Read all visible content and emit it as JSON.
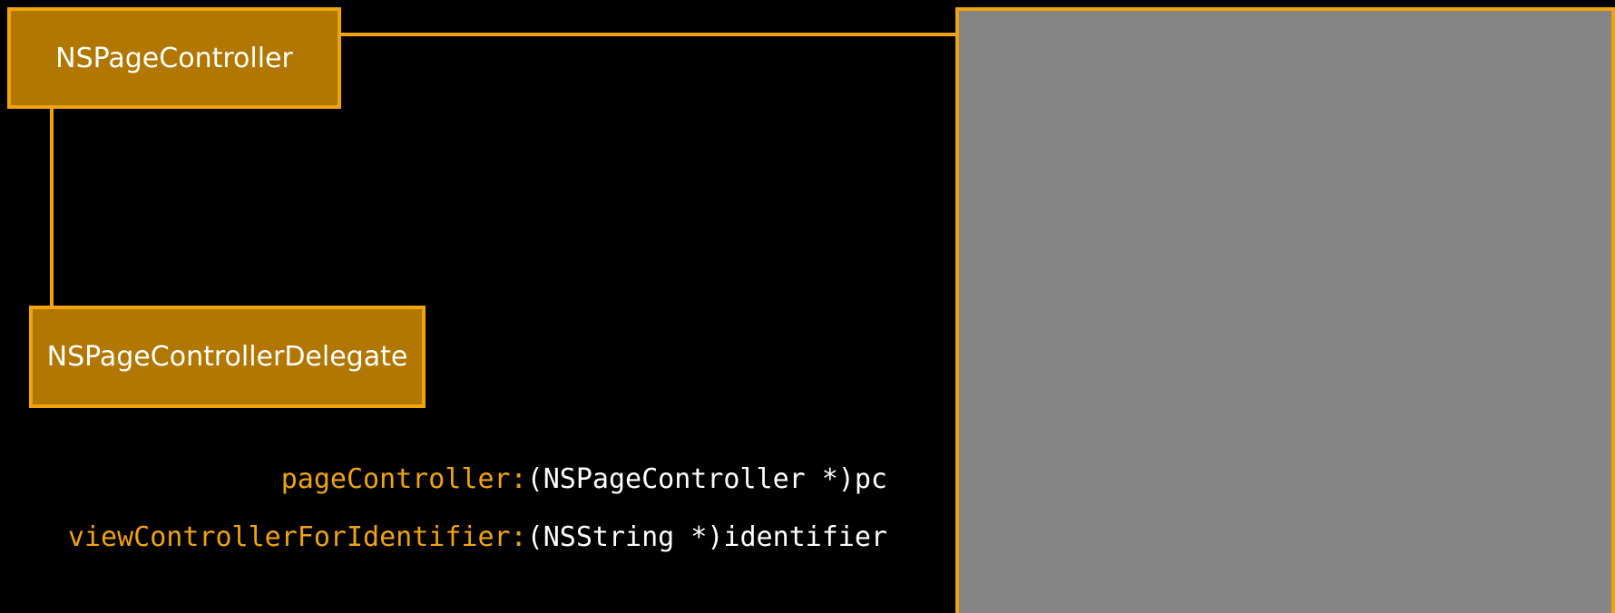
{
  "diagram": {
    "page_controller_box": {
      "label": "NSPageController"
    },
    "delegate_box": {
      "label": "NSPageControllerDelegate"
    }
  },
  "code": {
    "lines": [
      {
        "selector": "pageController:",
        "argument": "(NSPageController *)pc"
      },
      {
        "selector": "viewControllerForIdentifier:",
        "argument": "(NSString *)identifier"
      }
    ]
  },
  "colors": {
    "background": "#000000",
    "box_fill": "#b17700",
    "box_border": "#f0a30a",
    "connector": "#f0a30a",
    "panel_fill": "#858585",
    "selector_text": "#f0a30a",
    "argument_text": "#ffffff"
  }
}
